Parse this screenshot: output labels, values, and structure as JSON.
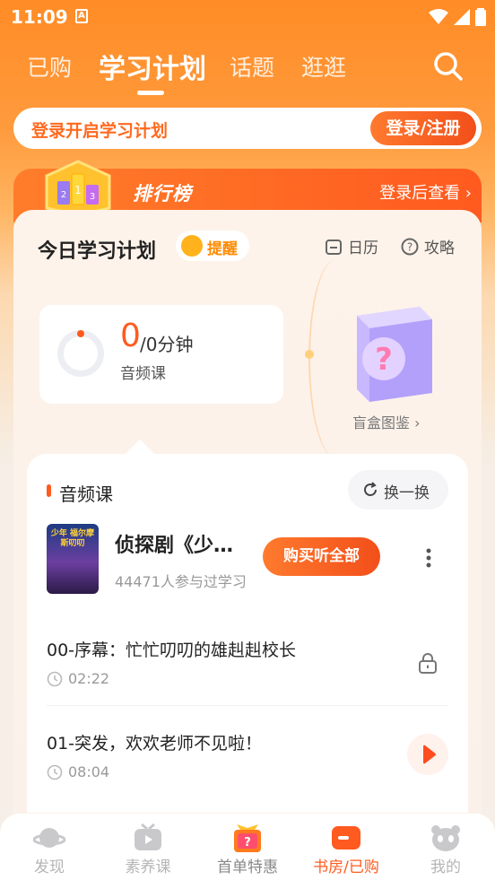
{
  "status": {
    "time": "11:09",
    "app_badge": "A"
  },
  "nav": {
    "tabs": [
      {
        "label": "已购",
        "active": false
      },
      {
        "label": "学习计划",
        "active": true
      },
      {
        "label": "话题",
        "active": false
      },
      {
        "label": "逛逛",
        "active": false
      }
    ],
    "search_icon": "search-icon"
  },
  "login": {
    "prompt": "登录开启学习计划",
    "button": "登录/注册"
  },
  "ranking": {
    "title": "排行榜",
    "more": "登录后查看 ›",
    "trophy_digits": [
      "2",
      "1",
      "3"
    ]
  },
  "plan": {
    "title": "今日学习计划",
    "remind": "提醒",
    "calendar": "日历",
    "guide": "攻略",
    "progress_value": "0",
    "progress_total": "/0分钟",
    "progress_type": "音频课",
    "progress_fraction": 0,
    "blindbox_label": "盲盒图鉴 ›"
  },
  "audio": {
    "section_title": "音频课",
    "swap": "换一换",
    "course": {
      "cover_text": "少年 福尔摩斯叨叨",
      "name": "侦探剧《少…",
      "participants": "44471人参与过学习",
      "buy": "购买听全部"
    },
    "lessons": [
      {
        "title": "00-序幕：忙忙叨叨的雄赳赳校长",
        "duration": "02:22",
        "state": "locked"
      },
      {
        "title": "01-突发，欢欢老师不见啦！",
        "duration": "08:04",
        "state": "playable"
      }
    ]
  },
  "tabbar": {
    "items": [
      {
        "label": "发现",
        "icon": "planet-icon",
        "active": false
      },
      {
        "label": "素养课",
        "icon": "tv-icon",
        "active": false
      },
      {
        "label": "首单特惠",
        "icon": "gift-icon",
        "active": false
      },
      {
        "label": "书房/已购",
        "icon": "study-icon",
        "active": true
      },
      {
        "label": "我的",
        "icon": "panda-icon",
        "active": false
      }
    ]
  },
  "colors": {
    "accent": "#ff5a1f",
    "orange": "#ff8c26",
    "muted": "#999999"
  }
}
